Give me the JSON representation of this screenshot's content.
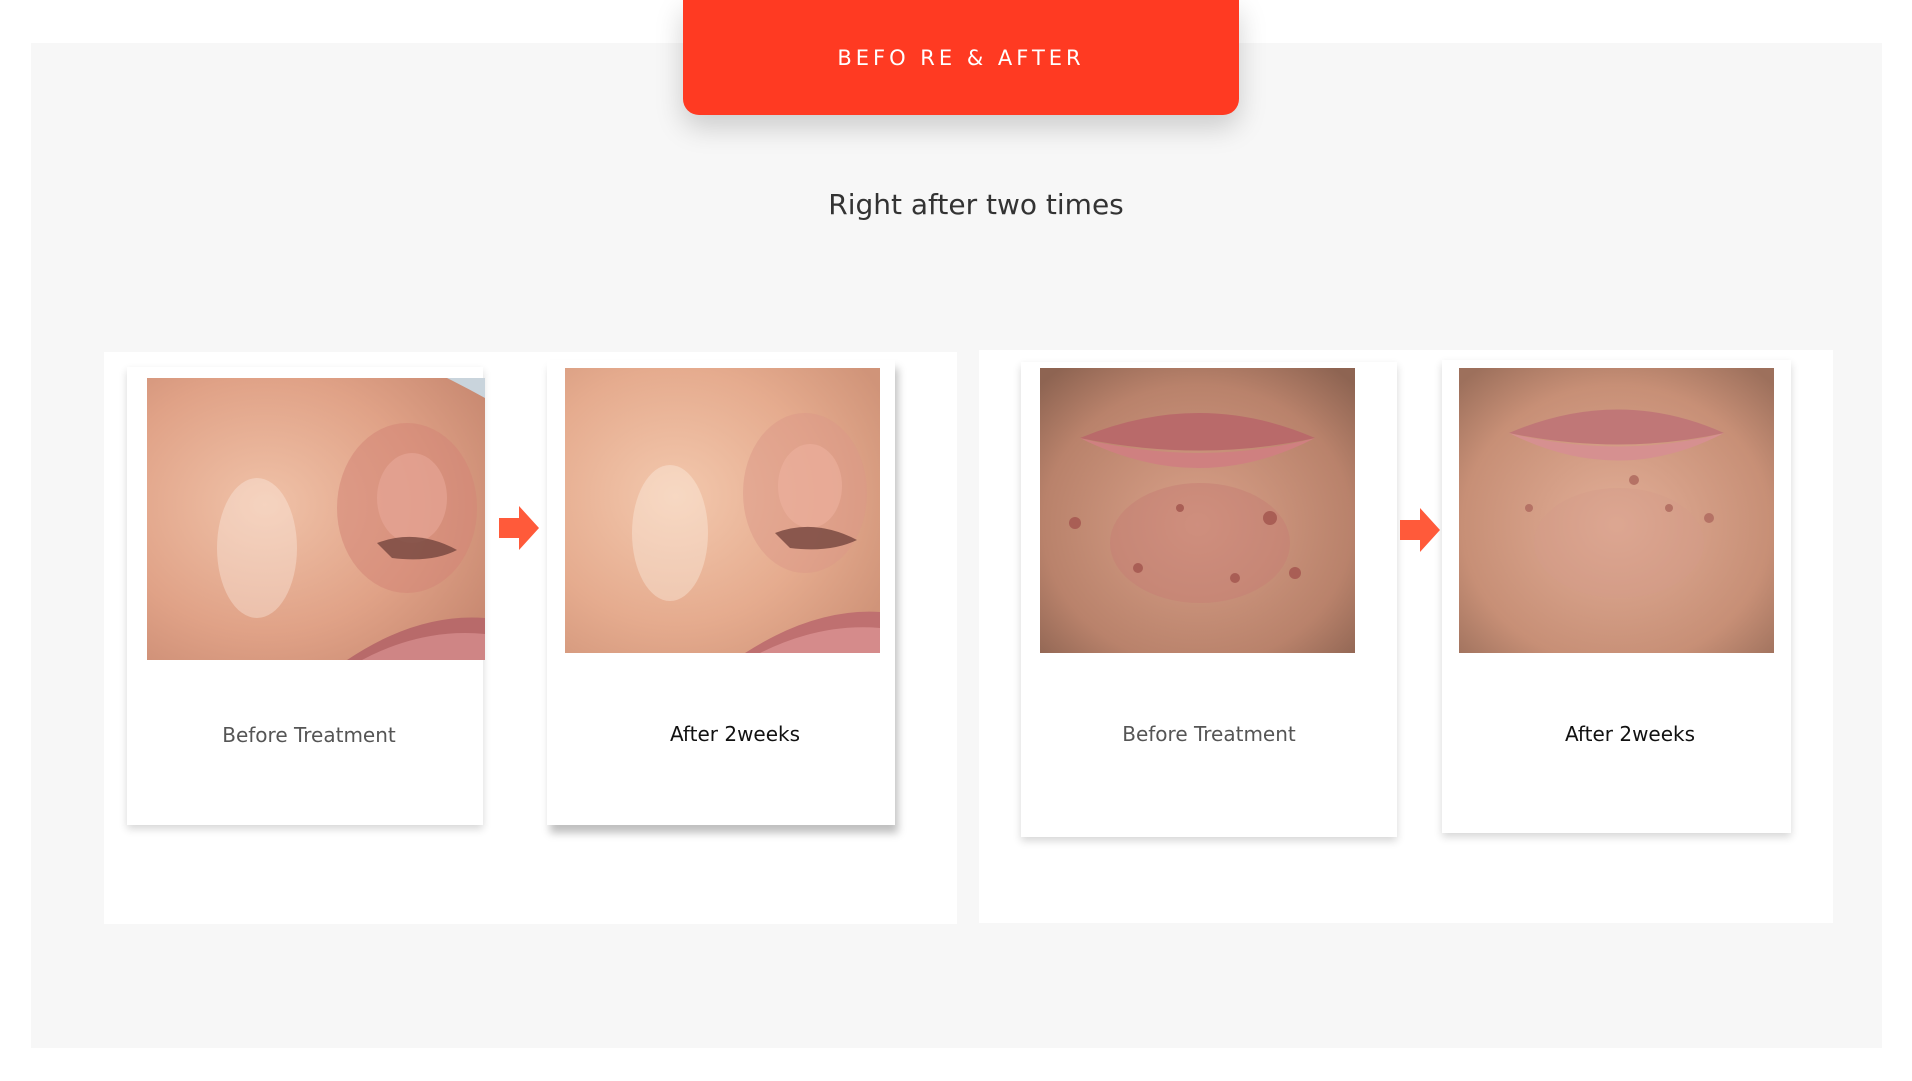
{
  "banner": {
    "title": "BEFO RE &  AFTER"
  },
  "subtitle": "Right after two times",
  "colors": {
    "accent": "#ff3a22",
    "arrow": "#ff5a3a",
    "panel_background": "#f7f7f7"
  },
  "comparisons": [
    {
      "area": "nose-cheek",
      "before": {
        "label": "Before Treatment"
      },
      "after": {
        "label": "After 2weeks"
      }
    },
    {
      "area": "lips-chin",
      "before": {
        "label": "Before Treatment"
      },
      "after": {
        "label": "After 2weeks"
      }
    }
  ],
  "icons": {
    "transition_arrow": "arrow-right-icon"
  }
}
